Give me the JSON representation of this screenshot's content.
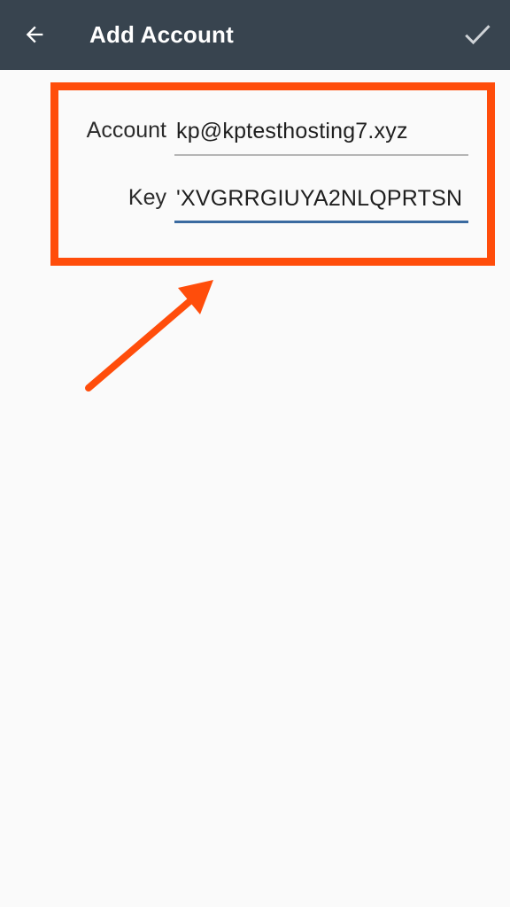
{
  "app_bar": {
    "title": "Add Account",
    "back_icon": "arrow-left-icon",
    "confirm_icon": "checkmark-icon",
    "background_color": "#38444f"
  },
  "form": {
    "account": {
      "label": "Account",
      "value": "kp@kptesthosting7.xyz"
    },
    "key": {
      "label": "Key",
      "value": "'XVGRRGIUYA2NLQPRTSN",
      "focused": true
    }
  },
  "annotation": {
    "color": "#ff4d0b",
    "shapes": [
      "highlight-box",
      "arrow"
    ]
  }
}
